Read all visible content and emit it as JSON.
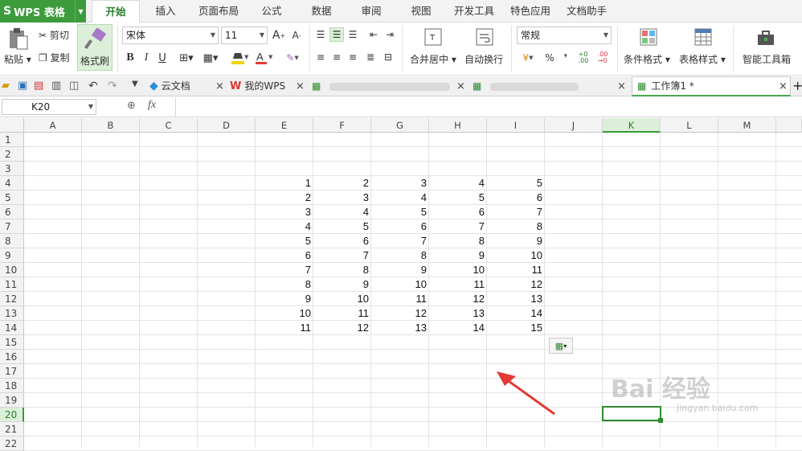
{
  "app": {
    "name": "WPS 表格",
    "logo": "S"
  },
  "menu": [
    "开始",
    "插入",
    "页面布局",
    "公式",
    "数据",
    "审阅",
    "视图",
    "开发工具",
    "特色应用",
    "文档助手"
  ],
  "ribbon": {
    "paste": "粘贴",
    "cut": "剪切",
    "copy": "复制",
    "format_painter": "格式刷",
    "font_name": "宋体",
    "font_size": "11",
    "merge_center": "合并居中",
    "wrap_text": "自动换行",
    "number_format": "常规",
    "conditional_format": "条件格式",
    "table_style": "表格样式",
    "smart_toolbox": "智能工具箱",
    "percent": "%",
    "comma": "❜"
  },
  "tabs": {
    "cloud_docs": "云文档",
    "my_wps": "我的WPS",
    "workbook": "工作簿1 *"
  },
  "formula_bar": {
    "cell_ref": "K20",
    "fx": "fx"
  },
  "columns": [
    "A",
    "B",
    "C",
    "D",
    "E",
    "F",
    "G",
    "H",
    "I",
    "J",
    "K",
    "L",
    "M"
  ],
  "rows": [
    "1",
    "2",
    "3",
    "4",
    "5",
    "6",
    "7",
    "8",
    "9",
    "10",
    "11",
    "12",
    "13",
    "14",
    "15",
    "16",
    "17",
    "18",
    "19",
    "20",
    "21",
    "22"
  ],
  "table": [
    [
      1,
      2,
      3,
      4,
      5
    ],
    [
      2,
      3,
      4,
      5,
      6
    ],
    [
      3,
      4,
      5,
      6,
      7
    ],
    [
      4,
      5,
      6,
      7,
      8
    ],
    [
      5,
      6,
      7,
      8,
      9
    ],
    [
      6,
      7,
      8,
      9,
      10
    ],
    [
      7,
      8,
      9,
      10,
      11
    ],
    [
      8,
      9,
      10,
      11,
      12
    ],
    [
      9,
      10,
      11,
      12,
      13
    ],
    [
      10,
      11,
      12,
      13,
      14
    ],
    [
      11,
      12,
      13,
      14,
      15
    ]
  ],
  "selected": {
    "column": "K",
    "row": "20"
  },
  "watermark": {
    "text": "Bai 经验",
    "sub": "jingyan.baidu.com"
  },
  "colors": {
    "accent": "#3c9c3c",
    "arrow": "#e53935"
  }
}
